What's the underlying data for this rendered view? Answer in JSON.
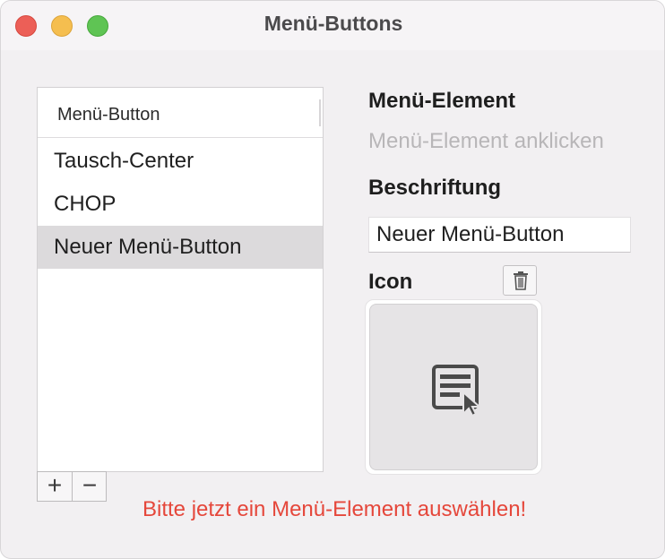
{
  "window": {
    "title": "Menü-Buttons"
  },
  "list": {
    "header_label": "Menü-Button",
    "items": [
      {
        "label": "Tausch-Center",
        "selected": false
      },
      {
        "label": "CHOP",
        "selected": false
      },
      {
        "label": "Neuer Menü-Button",
        "selected": true
      }
    ],
    "add_label": "+",
    "remove_label": "−"
  },
  "detail": {
    "menu_element_heading": "Menü-Element",
    "menu_element_hint": "Menü-Element anklicken",
    "caption_heading": "Beschriftung",
    "caption_value": "Neuer Menü-Button",
    "icon_heading": "Icon",
    "delete_icon": "trash-icon",
    "preview_icon": "menu-button-cursor-icon"
  },
  "status": {
    "message": "Bitte jetzt ein Menü-Element auswählen!",
    "color": "#e5473b"
  },
  "colors": {
    "close": "#ec5f57",
    "minimize": "#f5be4f",
    "maximize": "#5fc454",
    "selection": "#dcdadc"
  }
}
